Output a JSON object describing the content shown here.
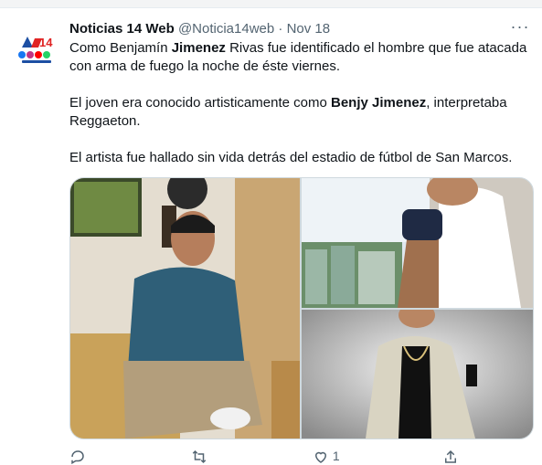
{
  "tweet": {
    "display_name": "Noticias 14 Web",
    "handle": "@Noticia14web",
    "separator": "·",
    "date": "Nov 18",
    "more_label": "···",
    "avatar_text": "14",
    "paragraphs": [
      {
        "segments": [
          {
            "text": "Como Benjamín ",
            "bold": false
          },
          {
            "text": "Jimenez",
            "bold": true
          },
          {
            "text": " Rivas fue identificado el hombre   que fue atacada con arma de fuego la noche de éste viernes.",
            "bold": false
          }
        ]
      },
      {
        "segments": [
          {
            "text": "El joven  era conocido artisticamente como ",
            "bold": false
          },
          {
            "text": "Benjy Jimenez",
            "bold": true
          },
          {
            "text": ", interpretaba Reggaeton.",
            "bold": false
          }
        ]
      },
      {
        "segments": [
          {
            "text": "El artista fue hallado sin vida detrás del estadio de fútbol de San Marcos.",
            "bold": false
          }
        ]
      }
    ]
  },
  "actions": {
    "reply_count": "",
    "retweet_count": "",
    "like_count": "1"
  },
  "colors": {
    "text": "#0f1419",
    "secondary": "#536471",
    "border": "#cfd9de"
  }
}
